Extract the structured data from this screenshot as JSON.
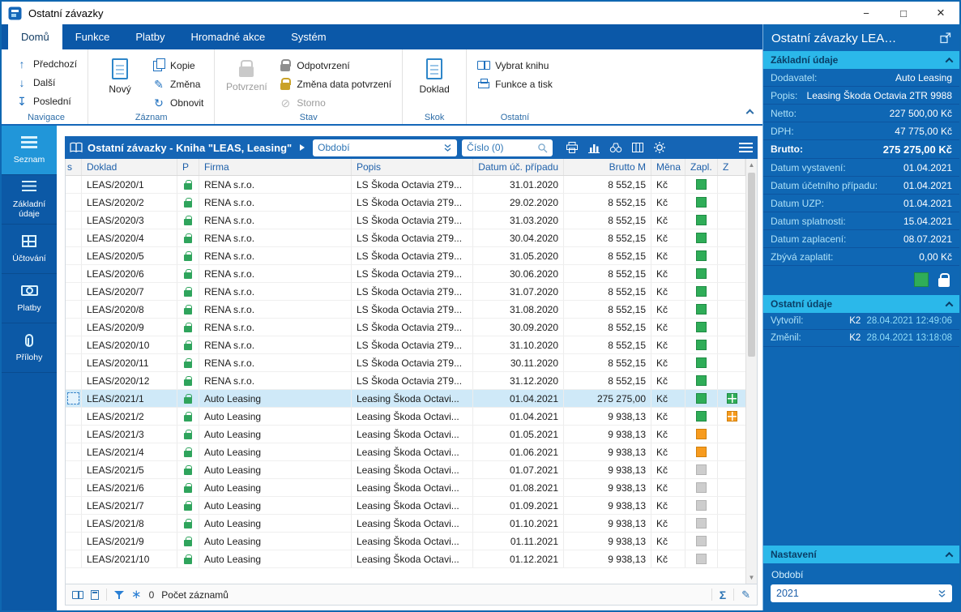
{
  "window": {
    "title": "Ostatní závazky"
  },
  "icons": {
    "minimize": "−",
    "maximize": "□",
    "close": "×",
    "prev": "↑",
    "next": "↓",
    "last": "↧",
    "edit": "✎",
    "refresh": "↻",
    "storno": "⊘",
    "freeze": "∗",
    "sum": "Σ",
    "pencil": "✎"
  },
  "colors": {
    "accent_blue": "#1565b5",
    "ribbon_blue": "#0b58a8",
    "panel_blue": "#0f67b4",
    "cyan": "#2bb8ea",
    "green": "#2fad58",
    "orange": "#f79b1e",
    "gray": "#cdcdcd"
  },
  "ribbon": {
    "tabs": [
      {
        "label": "Domů",
        "active": true
      },
      {
        "label": "Funkce"
      },
      {
        "label": "Platby"
      },
      {
        "label": "Hromadné akce"
      },
      {
        "label": "Systém"
      }
    ],
    "navigace": {
      "label": "Navigace",
      "items": [
        "Předchozí",
        "Další",
        "Poslední"
      ]
    },
    "zaznam": {
      "label": "Záznam",
      "big": "Nový",
      "items": [
        "Kopie",
        "Změna",
        "Obnovit"
      ]
    },
    "stav": {
      "label": "Stav",
      "big": "Potvrzení",
      "items": [
        "Odpotvrzení",
        "Změna data potvrzení",
        "Storno"
      ]
    },
    "skok": {
      "label": "Skok",
      "big": "Doklad"
    },
    "ostatni": {
      "label": "Ostatní",
      "items": [
        "Vybrat knihu",
        "Funkce a tisk"
      ]
    }
  },
  "sidebar": {
    "items": [
      {
        "label": "Seznam",
        "icon": "list",
        "active": true
      },
      {
        "label": "Základní údaje",
        "icon": "details"
      },
      {
        "label": "Účtování",
        "icon": "accounting"
      },
      {
        "label": "Platby",
        "icon": "payments"
      },
      {
        "label": "Přílohy",
        "icon": "attachments"
      }
    ]
  },
  "toolbar": {
    "book_title": "Ostatní závazky - Kniha \"LEAS, Leasing\"",
    "period_placeholder": "Období",
    "search_placeholder": "Číslo (0)"
  },
  "table": {
    "columns": [
      {
        "label": "s",
        "cls": "col-s"
      },
      {
        "label": "Doklad",
        "cls": "col-doklad"
      },
      {
        "label": "P",
        "cls": "col-p ctr"
      },
      {
        "label": "Firma",
        "cls": "col-firma"
      },
      {
        "label": "Popis",
        "cls": "col-popis"
      },
      {
        "label": "Datum úč. případu",
        "cls": "col-datum num"
      },
      {
        "label": "Brutto M",
        "cls": "col-brutto num"
      },
      {
        "label": "Měna",
        "cls": "col-mena"
      },
      {
        "label": "Zapl.",
        "cls": "col-zapl"
      },
      {
        "label": "Z",
        "cls": "col-z ctr"
      }
    ],
    "rows": [
      {
        "doklad": "LEAS/2020/1",
        "firma": "RENA s.r.o.",
        "popis": "LS Škoda Octavia 2T9...",
        "datum": "31.01.2020",
        "brutto": "8 552,15",
        "mena": "Kč",
        "zapl": "green"
      },
      {
        "doklad": "LEAS/2020/2",
        "firma": "RENA s.r.o.",
        "popis": "LS Škoda Octavia 2T9...",
        "datum": "29.02.2020",
        "brutto": "8 552,15",
        "mena": "Kč",
        "zapl": "green"
      },
      {
        "doklad": "LEAS/2020/3",
        "firma": "RENA s.r.o.",
        "popis": "LS Škoda Octavia 2T9...",
        "datum": "31.03.2020",
        "brutto": "8 552,15",
        "mena": "Kč",
        "zapl": "green"
      },
      {
        "doklad": "LEAS/2020/4",
        "firma": "RENA s.r.o.",
        "popis": "LS Škoda Octavia 2T9...",
        "datum": "30.04.2020",
        "brutto": "8 552,15",
        "mena": "Kč",
        "zapl": "green"
      },
      {
        "doklad": "LEAS/2020/5",
        "firma": "RENA s.r.o.",
        "popis": "LS Škoda Octavia 2T9...",
        "datum": "31.05.2020",
        "brutto": "8 552,15",
        "mena": "Kč",
        "zapl": "green"
      },
      {
        "doklad": "LEAS/2020/6",
        "firma": "RENA s.r.o.",
        "popis": "LS Škoda Octavia 2T9...",
        "datum": "30.06.2020",
        "brutto": "8 552,15",
        "mena": "Kč",
        "zapl": "green"
      },
      {
        "doklad": "LEAS/2020/7",
        "firma": "RENA s.r.o.",
        "popis": "LS Škoda Octavia 2T9...",
        "datum": "31.07.2020",
        "brutto": "8 552,15",
        "mena": "Kč",
        "zapl": "green"
      },
      {
        "doklad": "LEAS/2020/8",
        "firma": "RENA s.r.o.",
        "popis": "LS Škoda Octavia 2T9...",
        "datum": "31.08.2020",
        "brutto": "8 552,15",
        "mena": "Kč",
        "zapl": "green"
      },
      {
        "doklad": "LEAS/2020/9",
        "firma": "RENA s.r.o.",
        "popis": "LS Škoda Octavia 2T9...",
        "datum": "30.09.2020",
        "brutto": "8 552,15",
        "mena": "Kč",
        "zapl": "green"
      },
      {
        "doklad": "LEAS/2020/10",
        "firma": "RENA s.r.o.",
        "popis": "LS Škoda Octavia 2T9...",
        "datum": "31.10.2020",
        "brutto": "8 552,15",
        "mena": "Kč",
        "zapl": "green"
      },
      {
        "doklad": "LEAS/2020/11",
        "firma": "RENA s.r.o.",
        "popis": "LS Škoda Octavia 2T9...",
        "datum": "30.11.2020",
        "brutto": "8 552,15",
        "mena": "Kč",
        "zapl": "green"
      },
      {
        "doklad": "LEAS/2020/12",
        "firma": "RENA s.r.o.",
        "popis": "LS Škoda Octavia 2T9...",
        "datum": "31.12.2020",
        "brutto": "8 552,15",
        "mena": "Kč",
        "zapl": "green"
      },
      {
        "doklad": "LEAS/2021/1",
        "firma": "Auto Leasing",
        "popis": "Leasing Škoda Octavi...",
        "datum": "01.04.2021",
        "brutto": "275 275,00",
        "mena": "Kč",
        "zapl": "green",
        "z": "green",
        "selected": true
      },
      {
        "doklad": "LEAS/2021/2",
        "firma": "Auto Leasing",
        "popis": "Leasing Škoda Octavi...",
        "datum": "01.04.2021",
        "brutto": "9 938,13",
        "mena": "Kč",
        "zapl": "green",
        "z": "orange"
      },
      {
        "doklad": "LEAS/2021/3",
        "firma": "Auto Leasing",
        "popis": "Leasing Škoda Octavi...",
        "datum": "01.05.2021",
        "brutto": "9 938,13",
        "mena": "Kč",
        "zapl": "orange"
      },
      {
        "doklad": "LEAS/2021/4",
        "firma": "Auto Leasing",
        "popis": "Leasing Škoda Octavi...",
        "datum": "01.06.2021",
        "brutto": "9 938,13",
        "mena": "Kč",
        "zapl": "orange"
      },
      {
        "doklad": "LEAS/2021/5",
        "firma": "Auto Leasing",
        "popis": "Leasing Škoda Octavi...",
        "datum": "01.07.2021",
        "brutto": "9 938,13",
        "mena": "Kč",
        "zapl": "gray"
      },
      {
        "doklad": "LEAS/2021/6",
        "firma": "Auto Leasing",
        "popis": "Leasing Škoda Octavi...",
        "datum": "01.08.2021",
        "brutto": "9 938,13",
        "mena": "Kč",
        "zapl": "gray"
      },
      {
        "doklad": "LEAS/2021/7",
        "firma": "Auto Leasing",
        "popis": "Leasing Škoda Octavi...",
        "datum": "01.09.2021",
        "brutto": "9 938,13",
        "mena": "Kč",
        "zapl": "gray"
      },
      {
        "doklad": "LEAS/2021/8",
        "firma": "Auto Leasing",
        "popis": "Leasing Škoda Octavi...",
        "datum": "01.10.2021",
        "brutto": "9 938,13",
        "mena": "Kč",
        "zapl": "gray"
      },
      {
        "doklad": "LEAS/2021/9",
        "firma": "Auto Leasing",
        "popis": "Leasing Škoda Octavi...",
        "datum": "01.11.2021",
        "brutto": "9 938,13",
        "mena": "Kč",
        "zapl": "gray"
      },
      {
        "doklad": "LEAS/2021/10",
        "firma": "Auto Leasing",
        "popis": "Leasing Škoda Octavi...",
        "datum": "01.12.2021",
        "brutto": "9 938,13",
        "mena": "Kč",
        "zapl": "gray"
      }
    ]
  },
  "statusbar": {
    "freeze_count": "0",
    "records_label": "Počet záznamů"
  },
  "panel": {
    "title": "Ostatní závazky LEA…",
    "sections": {
      "zakladni": "Základní údaje",
      "ostatni": "Ostatní údaje",
      "nastaveni": "Nastavení"
    },
    "fields": [
      {
        "label": "Dodavatel:",
        "value": "Auto Leasing"
      },
      {
        "label": "Popis:",
        "value": "Leasing Škoda Octavia 2TR 9988"
      },
      {
        "label": "Netto:",
        "value": "227 500,00 Kč"
      },
      {
        "label": "DPH:",
        "value": "47 775,00 Kč"
      },
      {
        "label": "Brutto:",
        "value": "275 275,00 Kč",
        "bold": true
      },
      {
        "label": "Datum vystavení:",
        "value": "01.04.2021"
      },
      {
        "label": "Datum účetního případu:",
        "value": "01.04.2021"
      },
      {
        "label": "Datum UZP:",
        "value": "01.04.2021"
      },
      {
        "label": "Datum splatnosti:",
        "value": "15.04.2021"
      },
      {
        "label": "Datum zaplacení:",
        "value": "08.07.2021"
      },
      {
        "label": "Zbývá zaplatit:",
        "value": "0,00 Kč"
      }
    ],
    "audit": [
      {
        "label": "Vytvořil:",
        "user": "K2",
        "datetime": "28.04.2021 12:49:06"
      },
      {
        "label": "Změnil:",
        "user": "K2",
        "datetime": "28.04.2021 13:18:08"
      }
    ],
    "settings": {
      "period_label": "Období",
      "period_value": "2021"
    }
  }
}
